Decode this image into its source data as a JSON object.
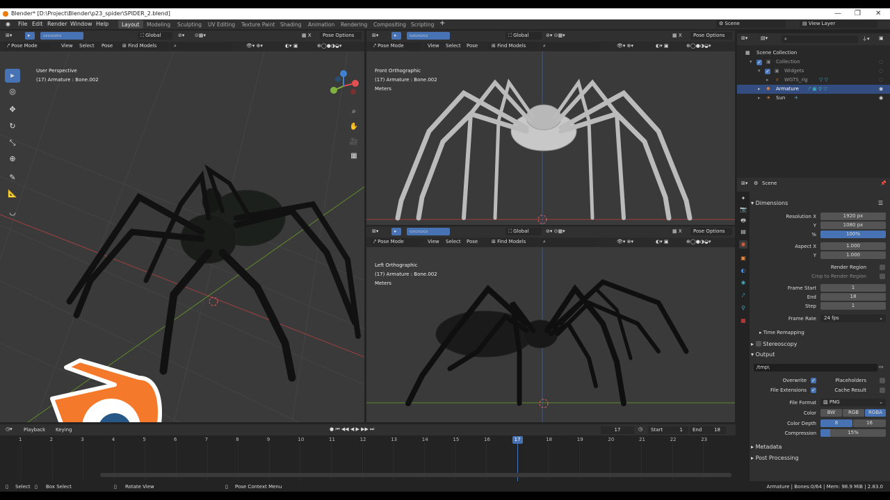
{
  "window": {
    "title": "Blender* [D:\\Project\\Blender\\p23_spider\\SPIDER_2.blend]"
  },
  "menu": [
    "File",
    "Edit",
    "Render",
    "Window",
    "Help"
  ],
  "workspaces": [
    "Layout",
    "Modeling",
    "Sculpting",
    "UV Editing",
    "Texture Paint",
    "Shading",
    "Animation",
    "Rendering",
    "Compositing",
    "Scripting"
  ],
  "scene_selector": "Scene",
  "view_layer": "View Layer",
  "viewport_header": {
    "mode": "Pose Mode",
    "view": "View",
    "select": "Select",
    "pose": "Pose",
    "find_models": "Find Models",
    "transform_orientation": "Global",
    "pose_options": "Pose Options"
  },
  "viewports": [
    {
      "view_name": "User Perspective",
      "object": "(17) Armature : Bone.002",
      "units": ""
    },
    {
      "view_name": "Front Orthographic",
      "object": "(17) Armature : Bone.002",
      "units": "Meters"
    },
    {
      "view_name": "Left Orthographic",
      "object": "(17) Armature : Bone.002",
      "units": "Meters"
    }
  ],
  "outliner": {
    "items": [
      {
        "label": "Scene Collection"
      },
      {
        "label": "Collection"
      },
      {
        "label": "Widgets"
      },
      {
        "label": "WGTS_rig"
      },
      {
        "label": "Armature"
      },
      {
        "label": "Sun"
      }
    ]
  },
  "properties": {
    "context": "Scene",
    "dimensions": {
      "title": "Dimensions",
      "resolution_x_label": "Resolution X",
      "resolution_x": "1920 px",
      "resolution_y_label": "Y",
      "resolution_y": "1080 px",
      "percent_label": "%",
      "percent": "100%",
      "aspect_x_label": "Aspect X",
      "aspect_x": "1.000",
      "aspect_y_label": "Y",
      "aspect_y": "1.000",
      "render_region": "Render Region",
      "crop_region": "Crop to Render Region",
      "frame_start_label": "Frame Start",
      "frame_start": "1",
      "end_label": "End",
      "end": "18",
      "step_label": "Step",
      "step": "1",
      "frame_rate_label": "Frame Rate",
      "frame_rate": "24 fps",
      "time_remapping": "Time Remapping"
    },
    "stereoscopy": "Stereoscopy",
    "output": {
      "title": "Output",
      "path": "/tmp\\",
      "overwrite": "Overwrite",
      "placeholders": "Placeholders",
      "file_extensions": "File Extensions",
      "cache_result": "Cache Result",
      "file_format_label": "File Format",
      "file_format": "PNG",
      "color_label": "Color",
      "color_options": [
        "BW",
        "RGB",
        "RGBA"
      ],
      "color_depth_label": "Color Depth",
      "color_depth_options": [
        "8",
        "16"
      ],
      "compression_label": "Compression",
      "compression": "15%"
    },
    "metadata": "Metadata",
    "post_processing": "Post Processing"
  },
  "timeline": {
    "playback": "Playback",
    "keying": "Keying",
    "current_frame": "17",
    "start_label": "Start",
    "start": "1",
    "end_label": "End",
    "end": "18",
    "ticks": [
      "1",
      "2",
      "3",
      "4",
      "5",
      "6",
      "7",
      "8",
      "9",
      "10",
      "11",
      "12",
      "13",
      "14",
      "15",
      "16",
      "17",
      "18",
      "19",
      "20",
      "21",
      "22",
      "23"
    ]
  },
  "statusbar": {
    "select": "Select",
    "box_select": "Box Select",
    "rotate_view": "Rotate View",
    "context_menu": "Pose Context Menu",
    "stats": "Armature | Bones:0/64 | Mem: 98.9 MiB | 2.83.0"
  },
  "colors": {
    "accent": "#4772b3",
    "logo_orange": "#f5792a",
    "logo_blue": "#265787"
  }
}
